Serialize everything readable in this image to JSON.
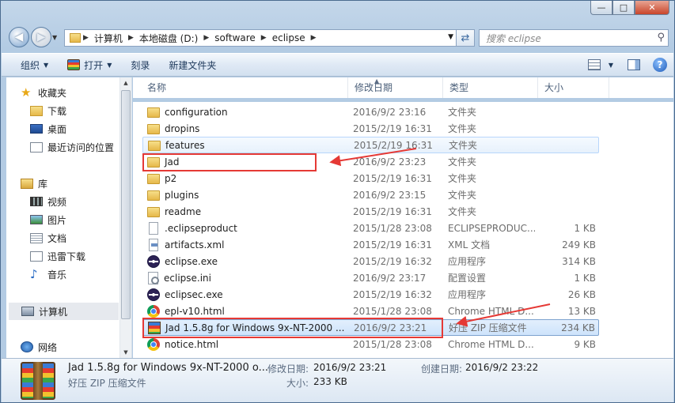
{
  "window": {
    "min_label": "—",
    "max_label": "□",
    "close_label": "✕"
  },
  "address": {
    "crumbs": [
      "计算机",
      "本地磁盘 (D:)",
      "software",
      "eclipse"
    ],
    "search_placeholder": "搜索 eclipse"
  },
  "toolbar": {
    "organize": "组织",
    "open": "打开",
    "burn": "刻录",
    "new_folder": "新建文件夹"
  },
  "nav": {
    "favorites": "收藏夹",
    "downloads": "下载",
    "desktop": "桌面",
    "recent": "最近访问的位置",
    "libraries": "库",
    "videos": "视频",
    "pictures": "图片",
    "documents": "文档",
    "xunlei": "迅雷下载",
    "music": "音乐",
    "computer": "计算机",
    "network": "网络"
  },
  "columns": {
    "name": "名称",
    "modified": "修改日期",
    "type": "类型",
    "size": "大小"
  },
  "files": [
    {
      "name": "configuration",
      "date": "2016/9/2 23:16",
      "type": "文件夹",
      "size": "",
      "icon": "folder-icon"
    },
    {
      "name": "dropins",
      "date": "2015/2/19 16:31",
      "type": "文件夹",
      "size": "",
      "icon": "folder-icon"
    },
    {
      "name": "features",
      "date": "2015/2/19 16:31",
      "type": "文件夹",
      "size": "",
      "icon": "folder-icon"
    },
    {
      "name": "Jad",
      "date": "2016/9/2 23:23",
      "type": "文件夹",
      "size": "",
      "icon": "folder-icon"
    },
    {
      "name": "p2",
      "date": "2015/2/19 16:31",
      "type": "文件夹",
      "size": "",
      "icon": "folder-icon"
    },
    {
      "name": "plugins",
      "date": "2016/9/2 23:15",
      "type": "文件夹",
      "size": "",
      "icon": "folder-icon"
    },
    {
      "name": "readme",
      "date": "2015/2/19 16:31",
      "type": "文件夹",
      "size": "",
      "icon": "folder-icon"
    },
    {
      "name": ".eclipseproduct",
      "date": "2015/1/28 23:08",
      "type": "ECLIPSEPRODUC...",
      "size": "1 KB",
      "icon": "file-icon"
    },
    {
      "name": "artifacts.xml",
      "date": "2015/2/19 16:31",
      "type": "XML 文档",
      "size": "249 KB",
      "icon": "xml-file-icon"
    },
    {
      "name": "eclipse.exe",
      "date": "2015/2/19 16:32",
      "type": "应用程序",
      "size": "314 KB",
      "icon": "eclipse-icon"
    },
    {
      "name": "eclipse.ini",
      "date": "2016/9/2 23:17",
      "type": "配置设置",
      "size": "1 KB",
      "icon": "ini-file-icon"
    },
    {
      "name": "eclipsec.exe",
      "date": "2015/2/19 16:32",
      "type": "应用程序",
      "size": "26 KB",
      "icon": "eclipse-icon"
    },
    {
      "name": "epl-v10.html",
      "date": "2015/1/28 23:08",
      "type": "Chrome HTML D...",
      "size": "13 KB",
      "icon": "chrome-icon"
    },
    {
      "name": "Jad 1.5.8g for Windows 9x-NT-2000 ...",
      "date": "2016/9/2 23:21",
      "type": "好压 ZIP 压缩文件",
      "size": "234 KB",
      "icon": "zip-icon"
    },
    {
      "name": "notice.html",
      "date": "2015/1/28 23:08",
      "type": "Chrome HTML D...",
      "size": "9 KB",
      "icon": "chrome-icon"
    }
  ],
  "details": {
    "filename": "Jad 1.5.8g for Windows 9x-NT-2000 o...",
    "filetype": "好压 ZIP 压缩文件",
    "modified_label": "修改日期:",
    "modified_value": "2016/9/2 23:21",
    "created_label": "创建日期:",
    "created_value": "2016/9/2 23:22",
    "size_label": "大小:",
    "size_value": "233 KB"
  },
  "colors": {
    "annotation_red": "#e53935",
    "selection_border": "#7da2ce"
  }
}
